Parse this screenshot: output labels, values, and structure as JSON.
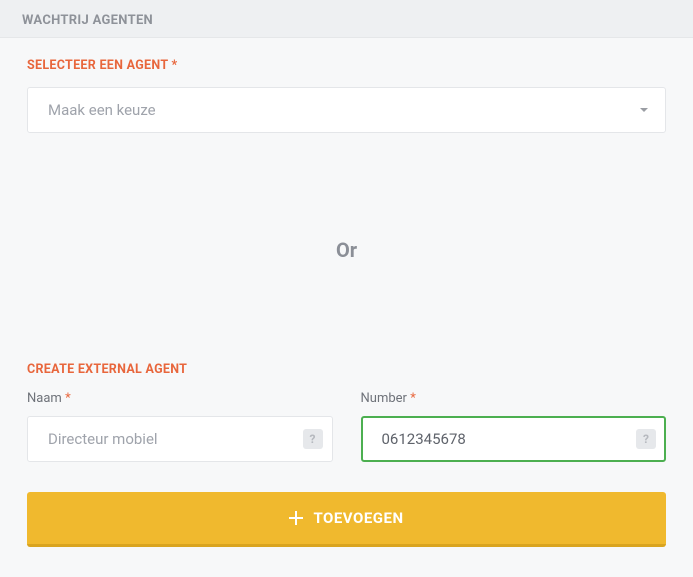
{
  "header": {
    "title": "WACHTRIJ AGENTEN"
  },
  "select_agent": {
    "label": "SELECTEER EEN AGENT",
    "required": "*",
    "placeholder": "Maak een keuze"
  },
  "divider": {
    "text": "Or"
  },
  "create_external": {
    "label": "CREATE EXTERNAL AGENT",
    "name_field": {
      "label": "Naam",
      "required": "*",
      "placeholder": "Directeur mobiel",
      "value": ""
    },
    "number_field": {
      "label": "Number",
      "required": "*",
      "placeholder": "",
      "value": "0612345678"
    }
  },
  "help_icon": {
    "glyph": "?"
  },
  "add_button": {
    "label": "TOEVOEGEN"
  }
}
